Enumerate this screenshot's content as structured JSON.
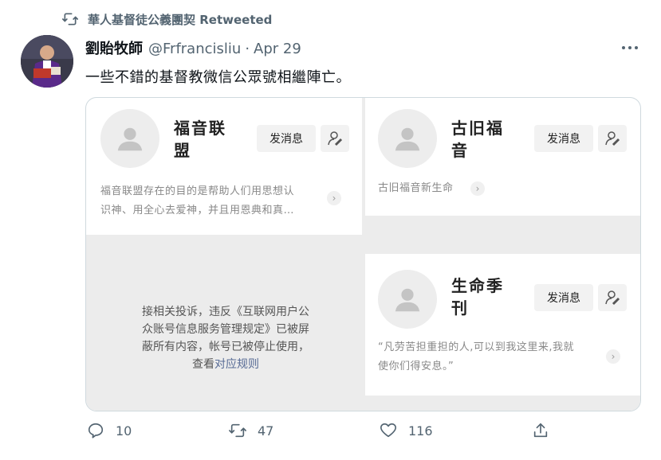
{
  "retweet": {
    "label": "華人基督徒公義團契 Retweeted"
  },
  "tweet": {
    "author_name": "劉貽牧師",
    "author_handle": "@Frfrancisliu",
    "separator": "·",
    "date": "Apr 29",
    "text": "一些不錯的基督教微信公眾號相繼陣亡。"
  },
  "accounts": [
    {
      "name_line1": "福音联",
      "name_line2": "盟",
      "message_label": "发消息",
      "description_line1": "福音联盟存在的目的是帮助人们用思想认",
      "description_line2": "识神、用全心去爱神，并且用恩典和真…"
    },
    {
      "name_line1": "古旧福",
      "name_line2": "音",
      "message_label": "发消息",
      "description_line1": "古旧福音新生命"
    },
    {
      "name_line1": "生命季",
      "name_line2": "刊",
      "message_label": "发消息",
      "description_line1": "“凡劳苦担重担的人,可以到我这里来,我就",
      "description_line2": "使你们得安息。”"
    }
  ],
  "blocked_notice": {
    "line1": "接相关投诉，违反《互联网用户公",
    "line2": "众账号信息服务管理规定》已被屏",
    "line3": "蔽所有内容，帐号已被停止使用，",
    "line4_prefix": "查看",
    "line4_link": "对应规则"
  },
  "actions": {
    "replies": "10",
    "retweets": "47",
    "likes": "116"
  },
  "colors": {
    "text": "#0f1419",
    "secondary": "#536471",
    "border": "#cfd9de",
    "link": "#576b95"
  }
}
